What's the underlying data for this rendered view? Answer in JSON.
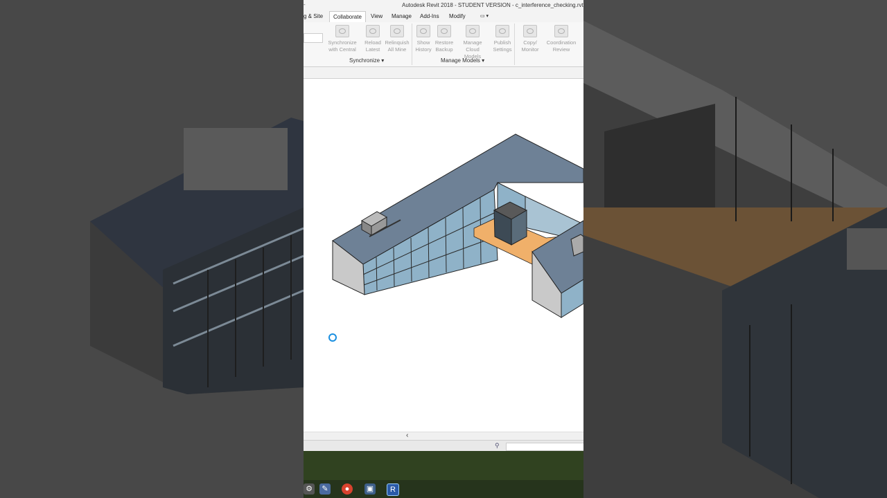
{
  "window": {
    "title": "Autodesk Revit 2018 -  STUDENT VERSION -   c_interference_checking.rvt -"
  },
  "tabs": [
    {
      "label": "g & Site",
      "active": false
    },
    {
      "label": "Collaborate",
      "active": true
    },
    {
      "label": "View",
      "active": false
    },
    {
      "label": "Manage",
      "active": false
    },
    {
      "label": "Add-Ins",
      "active": false
    },
    {
      "label": "Modify",
      "active": false
    }
  ],
  "ribbon": {
    "synchronize": {
      "buttons": [
        {
          "line1": "Synchronize",
          "line2": "with Central"
        },
        {
          "line1": "Reload",
          "line2": "Latest"
        },
        {
          "line1": "Relinquish",
          "line2": "All Mine"
        }
      ],
      "panel_label": "Synchronize"
    },
    "manage_models": {
      "buttons": [
        {
          "line1": "Show",
          "line2": "History"
        },
        {
          "line1": "Restore",
          "line2": "Backup"
        },
        {
          "line1": "Manage",
          "line2": "Cloud Models"
        },
        {
          "line1": "Publish",
          "line2": "Settings"
        }
      ],
      "panel_label": "Manage Models"
    },
    "coordinate": {
      "buttons": [
        {
          "line1": "Copy/",
          "line2": "Monitor"
        },
        {
          "line1": "Coordination",
          "line2": "Review"
        }
      ]
    }
  },
  "colors": {
    "roof": "#6e8196",
    "floor": "#f0b06a",
    "glass": "#8fb2c8",
    "wall": "#c9c9c9",
    "taskbar": "#304220",
    "accent": "#1a8fe0"
  },
  "taskbar_icons": [
    "paint-icon",
    "chrome-icon",
    "save-icon",
    "revit-icon"
  ],
  "taskbar_labels": {
    "revit": "R"
  }
}
